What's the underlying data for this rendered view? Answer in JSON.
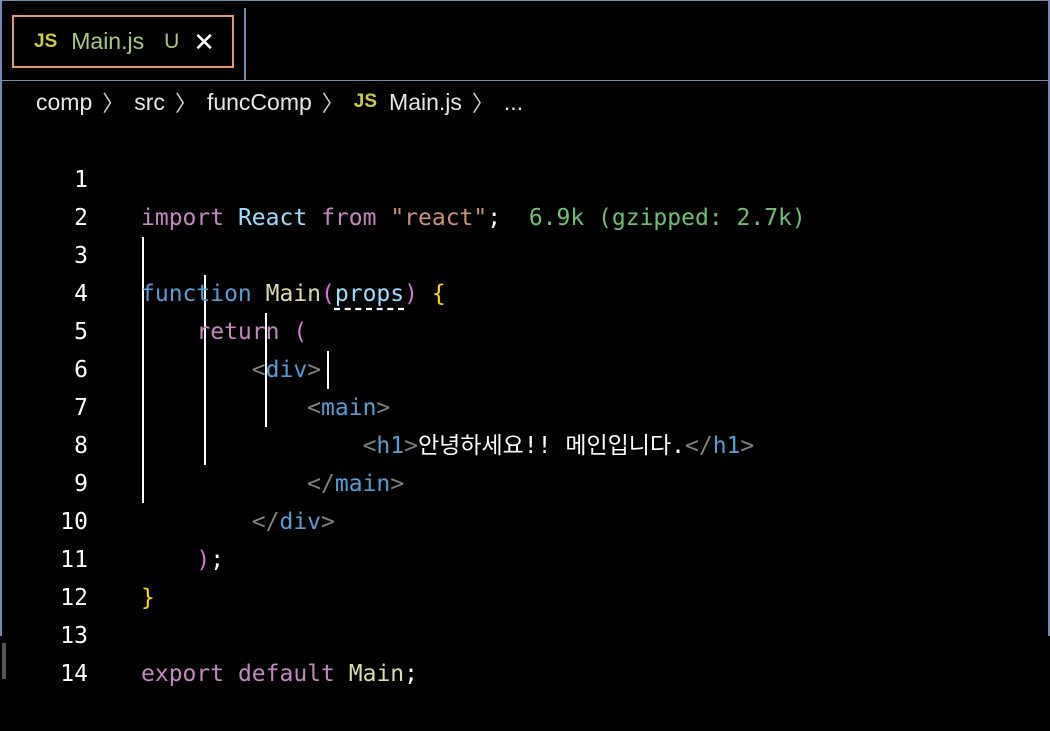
{
  "tab": {
    "icon": "JS",
    "name": "Main.js",
    "status": "U",
    "close": "✕"
  },
  "breadcrumb": {
    "items": [
      "comp",
      "src",
      "funcComp"
    ],
    "file_icon": "JS",
    "file": "Main.js",
    "more": "...",
    "sep": "〉"
  },
  "colors": {
    "tab_border": "#e3966f",
    "frame": "#6d8bb5",
    "import_hint": "#6fbf73"
  },
  "editor": {
    "line_numbers": [
      "1",
      "2",
      "3",
      "4",
      "5",
      "6",
      "7",
      "8",
      "9",
      "10",
      "11",
      "12",
      "13",
      "14"
    ],
    "l1": {
      "kw": "import",
      "name": "React",
      "from": "from",
      "str": "\"react\"",
      "semi": ";",
      "hint": "6.9k (gzipped: 2.7k)"
    },
    "l3": {
      "kw": "function",
      "name": "Main",
      "open": "(",
      "param": "props",
      "close": ")",
      "brace": "{"
    },
    "l4": {
      "kw": "return",
      "paren": "("
    },
    "l5": {
      "lt": "<",
      "tag": "div",
      "gt": ">"
    },
    "l6": {
      "lt": "<",
      "tag": "main",
      "gt": ">"
    },
    "l7": {
      "lt": "<",
      "tag": "h1",
      "gt": ">",
      "text": "안녕하세요!! 메인입니다.",
      "lt2": "</",
      "tag2": "h1",
      "gt2": ">"
    },
    "l8": {
      "lt": "</",
      "tag": "main",
      "gt": ">"
    },
    "l9": {
      "lt": "</",
      "tag": "div",
      "gt": ">"
    },
    "l10": {
      "paren": ")",
      "semi": ";"
    },
    "l11": {
      "brace": "}"
    },
    "l13": {
      "kw1": "export",
      "kw2": "default",
      "name": "Main",
      "semi": ";"
    }
  }
}
